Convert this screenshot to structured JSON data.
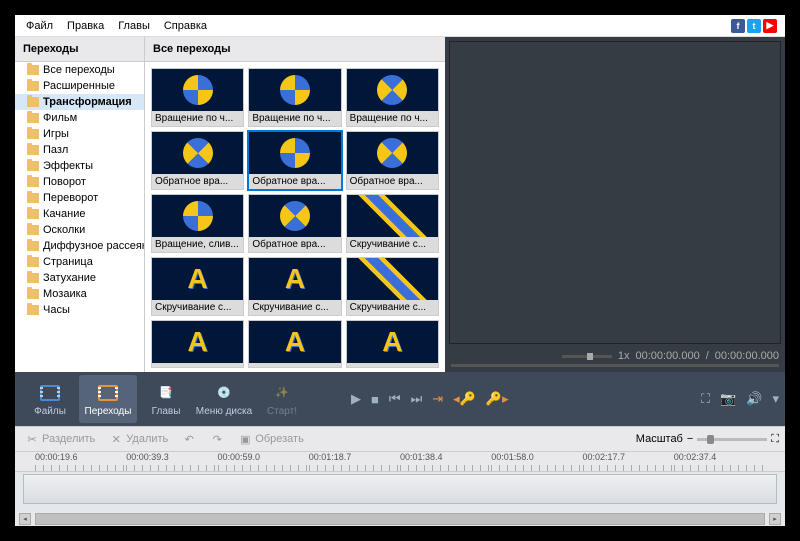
{
  "menu": {
    "file": "Файл",
    "edit": "Правка",
    "chapters": "Главы",
    "help": "Справка"
  },
  "sidebar": {
    "header": "Переходы",
    "items": [
      "Все переходы",
      "Расширенные",
      "Трансформация",
      "Фильм",
      "Игры",
      "Пазл",
      "Эффекты",
      "Поворот",
      "Переворот",
      "Качание",
      "Осколки",
      "Диффузное рассеяние",
      "Страница",
      "Затухание",
      "Мозаика",
      "Часы"
    ],
    "selected": 2
  },
  "gallery": {
    "header": "Все переходы",
    "selected": 4,
    "items": [
      {
        "label": "Вращение по ч...",
        "v": "swirl"
      },
      {
        "label": "Вращение по ч...",
        "v": "swirl"
      },
      {
        "label": "Вращение по ч...",
        "v": "swirl2"
      },
      {
        "label": "Обратное вра...",
        "v": "swirl2"
      },
      {
        "label": "Обратное вра...",
        "v": "swirl"
      },
      {
        "label": "Обратное вра...",
        "v": "swirl2"
      },
      {
        "label": "Вращение, слив...",
        "v": "swirl"
      },
      {
        "label": "Обратное вра...",
        "v": "swirl2"
      },
      {
        "label": "Скручивание с...",
        "v": "diag"
      },
      {
        "label": "Скручивание с...",
        "v": "letter"
      },
      {
        "label": "Скручивание с...",
        "v": "letter"
      },
      {
        "label": "Скручивание с...",
        "v": "diag"
      },
      {
        "label": "",
        "v": "letter"
      },
      {
        "label": "",
        "v": "letter"
      },
      {
        "label": "",
        "v": "letter"
      }
    ]
  },
  "preview": {
    "speed": "1x",
    "time_current": "00:00:00.000",
    "time_total": "00:00:00.000"
  },
  "toolbar": {
    "files": "Файлы",
    "transitions": "Переходы",
    "chapters": "Главы",
    "menu_disc": "Меню диска",
    "start": "Старт!"
  },
  "editbar": {
    "split": "Разделить",
    "delete": "Удалить",
    "crop": "Обрезать",
    "zoom": "Масштаб"
  },
  "ruler": [
    "00:00:19.6",
    "00:00:39.3",
    "00:00:59.0",
    "00:01:18.7",
    "00:01:38.4",
    "00:01:58.0",
    "00:02:17.7",
    "00:02:37.4"
  ]
}
